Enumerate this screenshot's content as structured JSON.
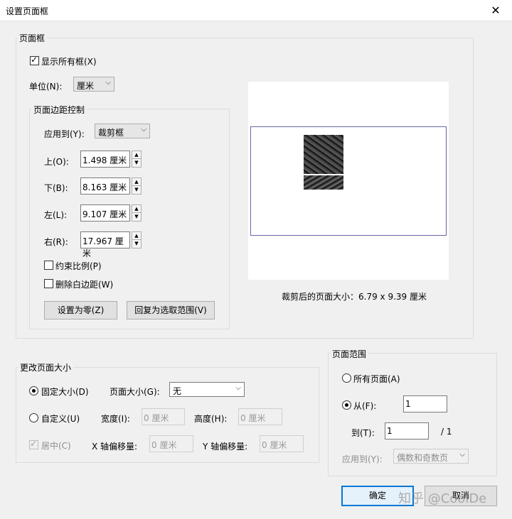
{
  "window": {
    "title": "设置页面框",
    "close_glyph": "✕"
  },
  "page_boxes": {
    "legend": "页面框",
    "show_all_label": "显示所有框(X)",
    "show_all_checked": true,
    "unit_label": "单位(N):",
    "unit_value": "厘米",
    "margin_control": {
      "legend": "页面边距控制",
      "apply_to_label": "应用到(Y):",
      "apply_to_value": "裁剪框",
      "top_label": "上(O):",
      "top_value": "1.498 厘米",
      "bottom_label": "下(B):",
      "bottom_value": "8.163 厘米",
      "left_label": "左(L):",
      "left_value": "9.107 厘米",
      "right_label": "右(R):",
      "right_value": "17.967 厘米",
      "constrain_label": "约束比例(P)",
      "remove_white_label": "删除白边距(W)",
      "set_zero_button": "设置为零(Z)",
      "revert_button": "回复为选取范围(V)"
    },
    "cropped_size_text": "裁剪后的页面大小：6.79 x 9.39 厘米"
  },
  "change_size": {
    "legend": "更改页面大小",
    "fixed_label": "固定大小(D)",
    "fixed_checked": true,
    "page_size_label": "页面大小(G):",
    "page_size_value": "无",
    "custom_label": "自定义(U)",
    "width_label": "宽度(I):",
    "width_value": "0 厘米",
    "height_label": "高度(H):",
    "height_value": "0 厘米",
    "center_label": "居中(C)",
    "x_offset_label": "X 轴偏移量:",
    "x_offset_value": "0 厘米",
    "y_offset_label": "Y 轴偏移量:",
    "y_offset_value": "0 厘米"
  },
  "page_range": {
    "legend": "页面范围",
    "all_label": "所有页面(A)",
    "from_label": "从(F):",
    "from_value": "1",
    "to_label": "到(T):",
    "to_value": "1",
    "total_text": "/ 1",
    "apply_to_label": "应用到(Y):",
    "apply_to_value": "偶数和奇数页"
  },
  "buttons": {
    "ok": "确定",
    "cancel": "取消"
  },
  "watermark": "知乎 @CoolDe",
  "icons": {
    "dropdown": "chevron-down-icon",
    "spin_up": "▲",
    "spin_down": "▼"
  }
}
